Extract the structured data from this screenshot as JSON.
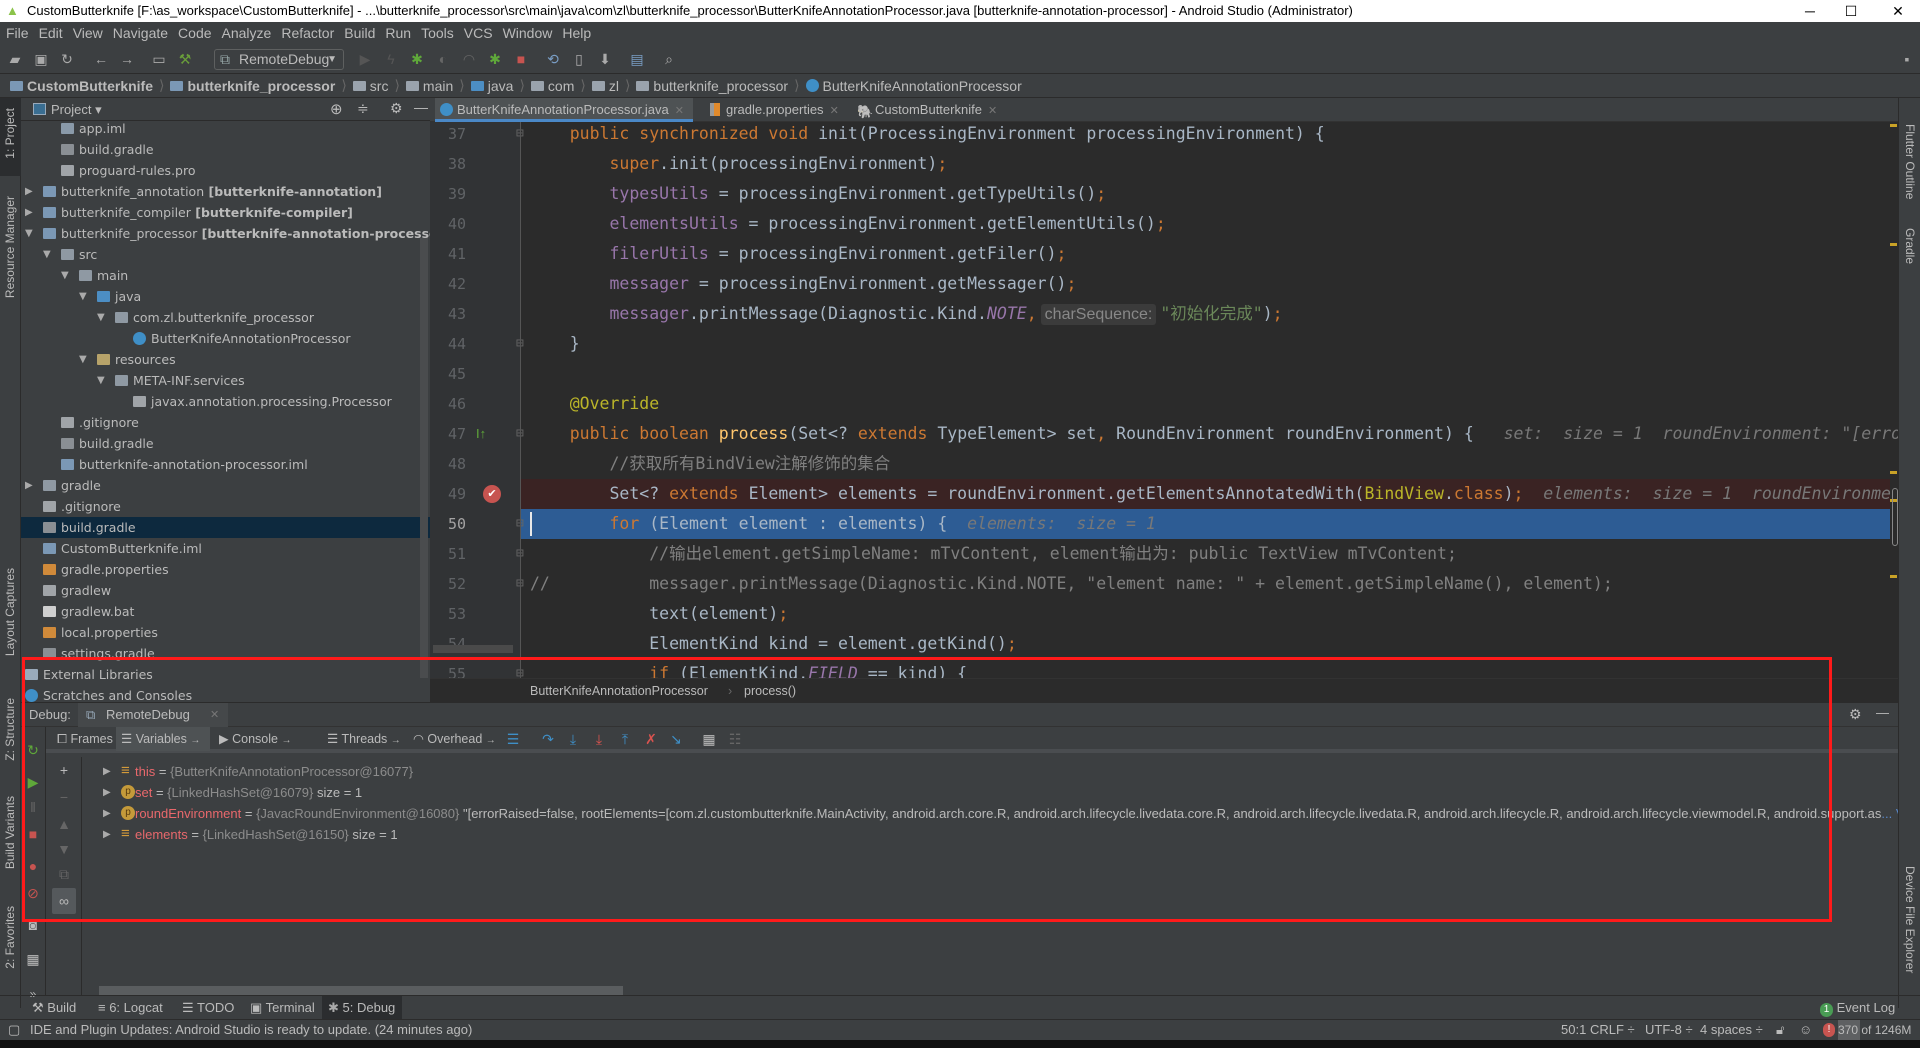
{
  "window": {
    "title": "CustomButterknife [F:\\as_workspace\\CustomButterknife] - ...\\butterknife_processor\\src\\main\\java\\com\\zl\\butterknife_processor\\ButterKnifeAnnotationProcessor.java [butterknife-annotation-processor] - Android Studio (Administrator)",
    "minimize": "─",
    "maximize": "☐",
    "close": "✕"
  },
  "menu": [
    "File",
    "Edit",
    "View",
    "Navigate",
    "Code",
    "Analyze",
    "Refactor",
    "Build",
    "Run",
    "Tools",
    "VCS",
    "Window",
    "Help"
  ],
  "toolbar": {
    "run_config": "RemoteDebug"
  },
  "navbar": [
    "CustomButterknife",
    "butterknife_processor",
    "src",
    "main",
    "java",
    "com",
    "zl",
    "butterknife_processor",
    "ButterKnifeAnnotationProcessor"
  ],
  "left_stripe": [
    "1: Project",
    "Resource Manager",
    "Layout Captures",
    "Z: Structure",
    "Build Variants",
    "2: Favorites"
  ],
  "right_stripe": [
    "Flutter Outline",
    "Gradle",
    "Device File Explorer"
  ],
  "project": {
    "title": "Project",
    "tree": [
      {
        "label": "app.iml",
        "depth": 3,
        "icon": "module-file"
      },
      {
        "label": "build.gradle",
        "depth": 3,
        "icon": "gradle"
      },
      {
        "label": "proguard-rules.pro",
        "depth": 3,
        "icon": "text-file"
      },
      {
        "label": "butterknife_annotation",
        "bold": "[butterknife-annotation]",
        "depth": 2,
        "arrow": "right",
        "icon": "module"
      },
      {
        "label": "butterknife_compiler",
        "bold": "[butterknife-compiler]",
        "depth": 2,
        "arrow": "right",
        "icon": "module-chart"
      },
      {
        "label": "butterknife_processor",
        "bold": "[butterknife-annotation-processor]",
        "depth": 2,
        "arrow": "down",
        "icon": "module"
      },
      {
        "label": "src",
        "depth": 3,
        "arrow": "down",
        "icon": "folder"
      },
      {
        "label": "main",
        "depth": 4,
        "arrow": "down",
        "icon": "folder"
      },
      {
        "label": "java",
        "depth": 5,
        "arrow": "down",
        "icon": "source-folder"
      },
      {
        "label": "com.zl.butterknife_processor",
        "depth": 6,
        "arrow": "down",
        "icon": "package"
      },
      {
        "label": "ButterKnifeAnnotationProcessor",
        "depth": 7,
        "icon": "class"
      },
      {
        "label": "resources",
        "depth": 5,
        "arrow": "down",
        "icon": "resources-folder"
      },
      {
        "label": "META-INF.services",
        "depth": 6,
        "arrow": "down",
        "icon": "package"
      },
      {
        "label": "javax.annotation.processing.Processor",
        "depth": 7,
        "icon": "text-file"
      },
      {
        "label": ".gitignore",
        "depth": 3,
        "icon": "text-file"
      },
      {
        "label": "build.gradle",
        "depth": 3,
        "icon": "gradle"
      },
      {
        "label": "butterknife-annotation-processor.iml",
        "depth": 3,
        "icon": "module"
      },
      {
        "label": "gradle",
        "depth": 2,
        "arrow": "right",
        "icon": "folder"
      },
      {
        "label": ".gitignore",
        "depth": 2,
        "icon": "text-file"
      },
      {
        "label": "build.gradle",
        "depth": 2,
        "icon": "gradle",
        "selected": true
      },
      {
        "label": "CustomButterknife.iml",
        "depth": 2,
        "icon": "module"
      },
      {
        "label": "gradle.properties",
        "depth": 2,
        "icon": "properties"
      },
      {
        "label": "gradlew",
        "depth": 2,
        "icon": "text-file"
      },
      {
        "label": "gradlew.bat",
        "depth": 2,
        "icon": "bat"
      },
      {
        "label": "local.properties",
        "depth": 2,
        "icon": "properties"
      },
      {
        "label": "settings.gradle",
        "depth": 2,
        "icon": "gradle"
      },
      {
        "label": "External Libraries",
        "depth": 1,
        "arrow": "right",
        "icon": "libraries"
      },
      {
        "label": "Scratches and Consoles",
        "depth": 1,
        "arrow": "right",
        "icon": "scratches"
      }
    ]
  },
  "editor": {
    "tabs": [
      {
        "label": "ButterKnifeAnnotationProcessor.java",
        "icon": "class",
        "active": true
      },
      {
        "label": "gradle.properties",
        "icon": "properties"
      },
      {
        "label": "CustomButterknife",
        "icon": "gradle"
      }
    ],
    "lines": [
      {
        "n": "37",
        "tokens": [
          [
            "plain",
            "    "
          ],
          [
            "kw",
            "public synchronized void "
          ],
          [
            "plain",
            "init(ProcessingEnvironment processingEnvironment) {"
          ]
        ]
      },
      {
        "n": "38",
        "tokens": [
          [
            "plain",
            "        "
          ],
          [
            "kw",
            "super"
          ],
          [
            "plain",
            ".init(processingEnvironment)"
          ],
          [
            "kw",
            ";"
          ]
        ]
      },
      {
        "n": "39",
        "tokens": [
          [
            "plain",
            "        "
          ],
          [
            "field",
            "typesUtils"
          ],
          [
            "plain",
            " = processingEnvironment.getTypeUtils()"
          ],
          [
            "kw",
            ";"
          ]
        ]
      },
      {
        "n": "40",
        "tokens": [
          [
            "plain",
            "        "
          ],
          [
            "field",
            "elementsUtils"
          ],
          [
            "plain",
            " = processingEnvironment.getElementUtils()"
          ],
          [
            "kw",
            ";"
          ]
        ]
      },
      {
        "n": "41",
        "tokens": [
          [
            "plain",
            "        "
          ],
          [
            "field",
            "filerUtils"
          ],
          [
            "plain",
            " = processingEnvironment.getFiler()"
          ],
          [
            "kw",
            ";"
          ]
        ]
      },
      {
        "n": "42",
        "tokens": [
          [
            "plain",
            "        "
          ],
          [
            "field",
            "messager"
          ],
          [
            "plain",
            " = processingEnvironment.getMessager()"
          ],
          [
            "kw",
            ";"
          ]
        ]
      },
      {
        "n": "43",
        "tokens": [
          [
            "plain",
            "        "
          ],
          [
            "field",
            "messager"
          ],
          [
            "plain",
            ".printMessage(Diagnostic.Kind."
          ],
          [
            "consti",
            "NOTE"
          ],
          [
            "kw",
            ","
          ],
          [
            "hintbox",
            "charSequence:"
          ],
          [
            "str",
            "\"初始化完成\""
          ],
          [
            "plain",
            ")"
          ],
          [
            "kw",
            ";"
          ]
        ]
      },
      {
        "n": "44",
        "tokens": [
          [
            "plain",
            "    }"
          ]
        ]
      },
      {
        "n": "45",
        "tokens": []
      },
      {
        "n": "46",
        "tokens": [
          [
            "ann",
            "    @Override"
          ]
        ]
      },
      {
        "n": "47",
        "tokens": [
          [
            "plain",
            "    "
          ],
          [
            "kw",
            "public boolean "
          ],
          [
            "method",
            "process"
          ],
          [
            "plain",
            "(Set<? "
          ],
          [
            "kw",
            "extends "
          ],
          [
            "plain",
            "TypeElement> set"
          ],
          [
            "kw",
            ", "
          ],
          [
            "plain",
            "RoundEnvironment roundEnvironment) {"
          ],
          [
            "hint",
            "   set:  size = 1  roundEnvironment: \"[erro"
          ]
        ]
      },
      {
        "n": "48",
        "tokens": [
          [
            "comment",
            "        //获取所有BindView注解修饰的集合"
          ]
        ]
      },
      {
        "n": "49",
        "tokens": [
          [
            "plain",
            "        Set<? "
          ],
          [
            "kw",
            "extends "
          ],
          [
            "plain",
            "Element> elements = roundEnvironment.getElementsAnnotatedWith("
          ],
          [
            "ann",
            "BindView"
          ],
          [
            "plain",
            "."
          ],
          [
            "kw",
            "class"
          ],
          [
            "plain",
            ")"
          ],
          [
            "kw",
            ";"
          ],
          [
            "hint",
            "  elements:  size = 1  roundEnvironme"
          ]
        ],
        "style": "breakpoint"
      },
      {
        "n": "50",
        "tokens": [
          [
            "plain",
            "        "
          ],
          [
            "kw",
            "for "
          ],
          [
            "plain",
            "(Element element : elements) {"
          ],
          [
            "hint",
            "  elements:  size = 1"
          ]
        ],
        "style": "current"
      },
      {
        "n": "51",
        "tokens": [
          [
            "comment",
            "            //输出element.getSimpleName: mTvContent, element输出为: public TextView mTvContent;"
          ]
        ]
      },
      {
        "n": "52",
        "tokens": [
          [
            "comment",
            "//          messager.printMessage(Diagnostic.Kind.NOTE, \"element name: \" + element.getSimpleName(), element);"
          ]
        ]
      },
      {
        "n": "53",
        "tokens": [
          [
            "plain",
            "            text(element)"
          ],
          [
            "kw",
            ";"
          ]
        ]
      },
      {
        "n": "54",
        "tokens": [
          [
            "plain",
            "            ElementKind kind = element.getKind()"
          ],
          [
            "kw",
            ";"
          ]
        ]
      },
      {
        "n": "55",
        "tokens": [
          [
            "plain",
            "            "
          ],
          [
            "kw",
            "if "
          ],
          [
            "plain",
            "(ElementKind."
          ],
          [
            "consti",
            "FIELD"
          ],
          [
            "plain",
            " == kind) {"
          ]
        ]
      }
    ],
    "breadcrumb": [
      "ButterKnifeAnnotationProcessor",
      "process()"
    ]
  },
  "debug": {
    "label": "Debug:",
    "session_tab": "RemoteDebug",
    "tabs": [
      "Frames",
      "Variables",
      "Console",
      "Threads",
      "Overhead"
    ],
    "selected_tab": "Variables",
    "variables": [
      {
        "icon": "field",
        "name": "this",
        "type": "{ButterKnifeAnnotationProcessor@16077}",
        "value": ""
      },
      {
        "icon": "param",
        "name": "set",
        "type": "{LinkedHashSet@16079}",
        "value": "size = 1"
      },
      {
        "icon": "param",
        "name": "roundEnvironment",
        "type": "{JavacRoundEnvironment@16080}",
        "value": "\"[errorRaised=false, rootElements=[com.zl.custombutterknife.MainActivity, android.arch.core.R, android.arch.lifecycle.livedata.core.R, android.arch.lifecycle.livedata.R, android.arch.lifecycle.R, android.arch.lifecycle.viewmodel.R, android.support.as",
        "link": "... View"
      },
      {
        "icon": "field",
        "name": "elements",
        "type": "{LinkedHashSet@16150}",
        "value": "size = 1"
      }
    ]
  },
  "bottom_tabs": [
    {
      "label": "Build",
      "icon": "hammer"
    },
    {
      "label": "6: Logcat",
      "icon": "logcat"
    },
    {
      "label": "TODO",
      "icon": "list"
    },
    {
      "label": "Terminal",
      "icon": "terminal"
    },
    {
      "label": "5: Debug",
      "icon": "bug",
      "selected": true
    }
  ],
  "event_log": {
    "label": "Event Log",
    "badge": "1"
  },
  "status": {
    "message": "IDE and Plugin Updates: Android Studio is ready to update. (24 minutes ago)",
    "position": "50:1",
    "line_sep": "CRLF ÷",
    "encoding": "UTF-8 ÷",
    "indent": "4 spaces ÷",
    "memory": "370 of 1246M"
  },
  "colors": {
    "accent": "#4a88c7",
    "annotation_box": "#ff1a1a",
    "breakpoint": "#c75450",
    "current_line": "#2d5c94"
  }
}
